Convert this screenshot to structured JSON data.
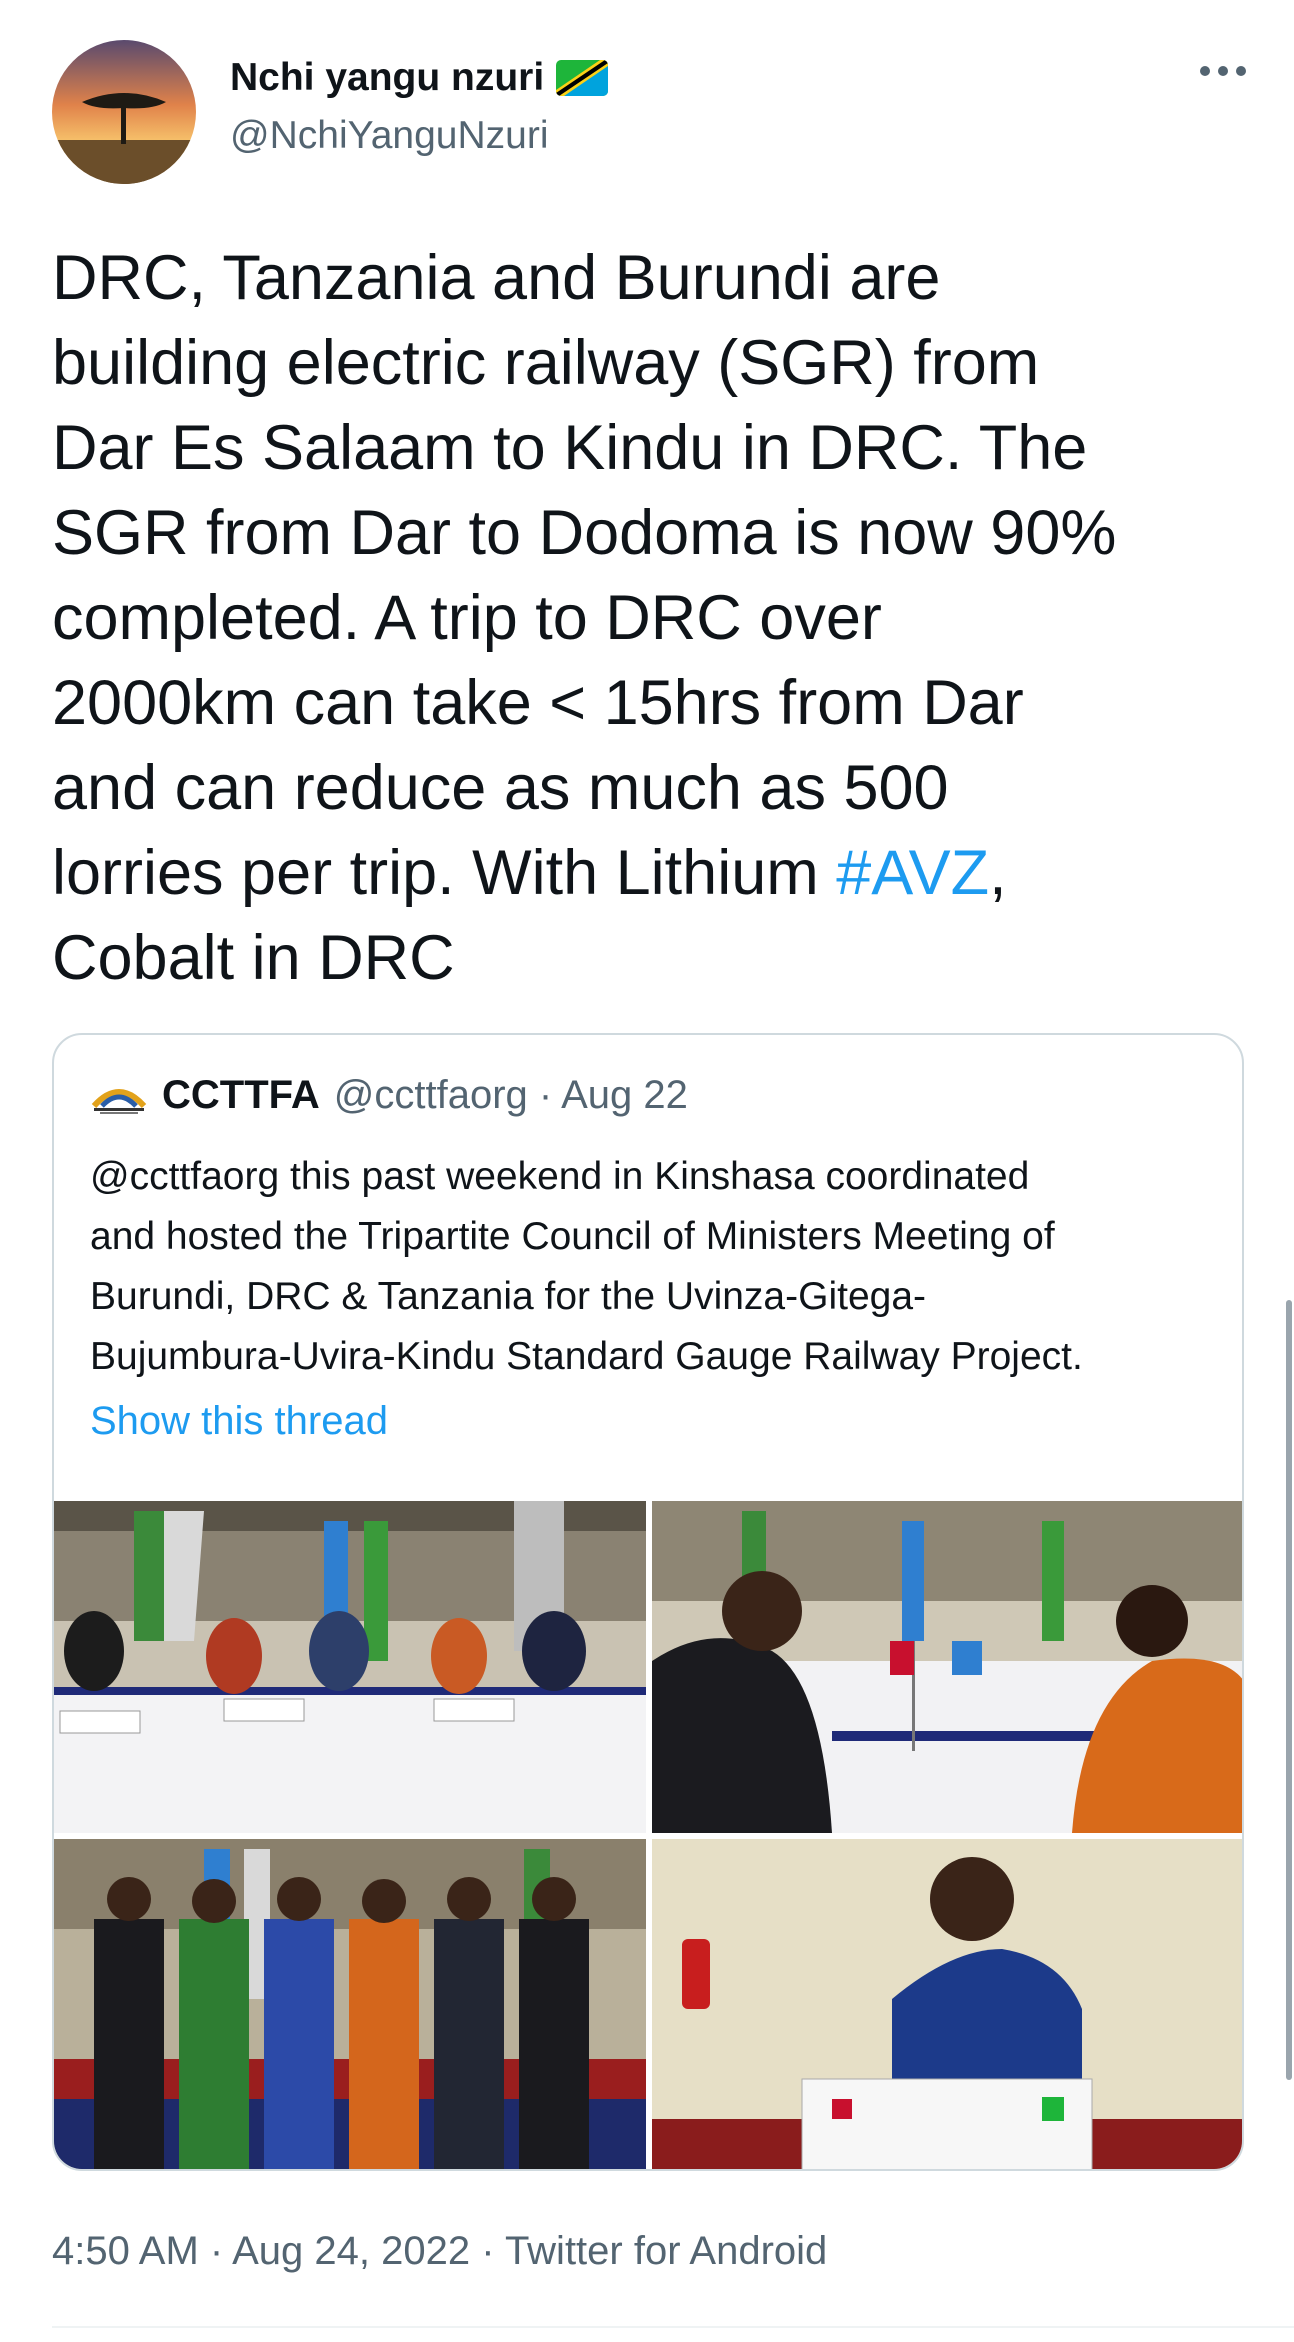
{
  "author": {
    "name": "Nchi yangu nzuri",
    "handle": "@NchiYanguNzuri",
    "flag_icon": "tanzania-flag-icon"
  },
  "tweet": {
    "text_lines": [
      "DRC, Tanzania and Burundi are",
      "building electric railway (SGR) from",
      "Dar Es Salaam to Kindu in DRC. The",
      "SGR from Dar to Dodoma is now 90%",
      "completed. A trip to DRC over",
      "2000km can take < 15hrs from Dar",
      "and can reduce as much as 500",
      "lorries per trip. With Lithium "
    ],
    "hashtag": "#AVZ",
    "after_hashtag": ",",
    "last_line": "Cobalt in DRC",
    "link_color": "#1d9bf0"
  },
  "quoted": {
    "name": "CCTTFA",
    "handle": "@ccttfaorg",
    "separator": " · ",
    "date": "Aug 22",
    "text": "@ccttfaorg this past weekend in Kinshasa coordinated\nand hosted the Tripartite Council of Ministers Meeting of\nBurundi, DRC & Tanzania for the Uvinza-Gitega-\nBujumbura-Uvira-Kindu Standard Gauge Railway Project.",
    "show_thread": "Show this thread",
    "photos": [
      "meeting-table-photo",
      "signing-photo",
      "group-photo",
      "podium-speaker-photo"
    ]
  },
  "footer": {
    "time": "4:50 AM",
    "sep1": " · ",
    "date": "Aug 24, 2022",
    "sep2": " · ",
    "client": "Twitter for Android"
  }
}
